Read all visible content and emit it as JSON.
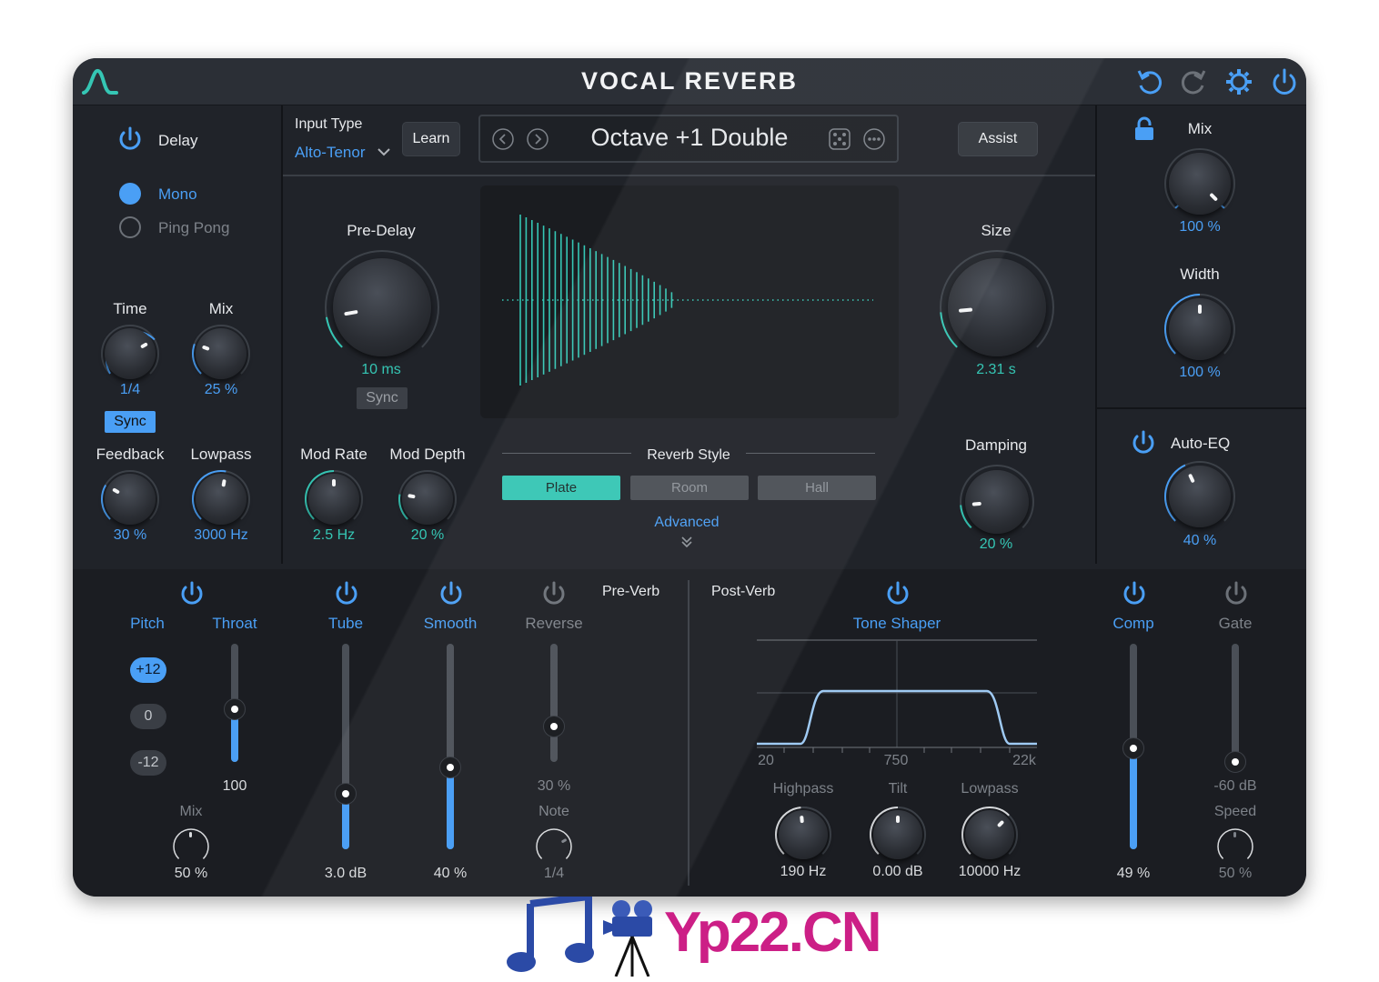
{
  "app": {
    "title": "VOCAL REVERB"
  },
  "delay": {
    "label": "Delay",
    "modes": [
      "Mono",
      "Ping Pong"
    ],
    "time": {
      "label": "Time",
      "value": "1/4",
      "sync": "Sync"
    },
    "mix": {
      "label": "Mix",
      "value": "25 %"
    },
    "feedback": {
      "label": "Feedback",
      "value": "30 %"
    },
    "lowpass": {
      "label": "Lowpass",
      "value": "3000 Hz"
    }
  },
  "input": {
    "label": "Input Type",
    "value": "Alto-Tenor",
    "learn": "Learn"
  },
  "preset": {
    "name": "Octave +1 Double",
    "assist": "Assist"
  },
  "predelay": {
    "label": "Pre-Delay",
    "value": "10 ms",
    "sync": "Sync"
  },
  "size": {
    "label": "Size",
    "value": "2.31 s"
  },
  "damping": {
    "label": "Damping",
    "value": "20 %"
  },
  "mod_rate": {
    "label": "Mod Rate",
    "value": "2.5 Hz"
  },
  "mod_depth": {
    "label": "Mod Depth",
    "value": "20 %"
  },
  "reverb_style": {
    "label": "Reverb Style",
    "options": [
      "Plate",
      "Room",
      "Hall"
    ],
    "selected": "Plate",
    "advanced": "Advanced"
  },
  "right": {
    "mix": {
      "label": "Mix",
      "value": "100 %"
    },
    "width": {
      "label": "Width",
      "value": "100 %"
    },
    "auto_eq": {
      "label": "Auto-EQ",
      "value": "40 %"
    }
  },
  "preverb": {
    "label": "Pre-Verb",
    "pitch": {
      "label": "Pitch",
      "options": [
        "+12",
        "0",
        "-12"
      ],
      "selected": "+12"
    },
    "throat": {
      "label": "Throat",
      "value": "100",
      "level": 0.45
    },
    "mix": {
      "label": "Mix",
      "value": "50 %"
    },
    "tube": {
      "label": "Tube",
      "value": "3.0 dB",
      "level": 0.27
    },
    "smooth": {
      "label": "Smooth",
      "value": "40 %",
      "level": 0.4
    },
    "reverse": {
      "label": "Reverse",
      "value": "30 %",
      "level": 0.3
    },
    "note": {
      "label": "Note",
      "value": "1/4"
    }
  },
  "postverb": {
    "label": "Post-Verb",
    "tone_shaper": {
      "label": "Tone Shaper",
      "axis": [
        "20",
        "750",
        "22k"
      ]
    },
    "highpass": {
      "label": "Highpass",
      "value": "190 Hz"
    },
    "tilt": {
      "label": "Tilt",
      "value": "0.00 dB"
    },
    "lowpass": {
      "label": "Lowpass",
      "value": "10000 Hz"
    },
    "comp": {
      "label": "Comp",
      "value": "49 %",
      "level": 0.49
    },
    "gate": {
      "label": "Gate",
      "value": "-60 dB",
      "speed_label": "Speed",
      "speed_value": "50 %",
      "level": 0.0
    }
  },
  "colors": {
    "accent": "#35c6b4",
    "blue": "#4a9ff5",
    "panel": "#202329"
  },
  "watermark": {
    "text": "Yp22.CN"
  }
}
